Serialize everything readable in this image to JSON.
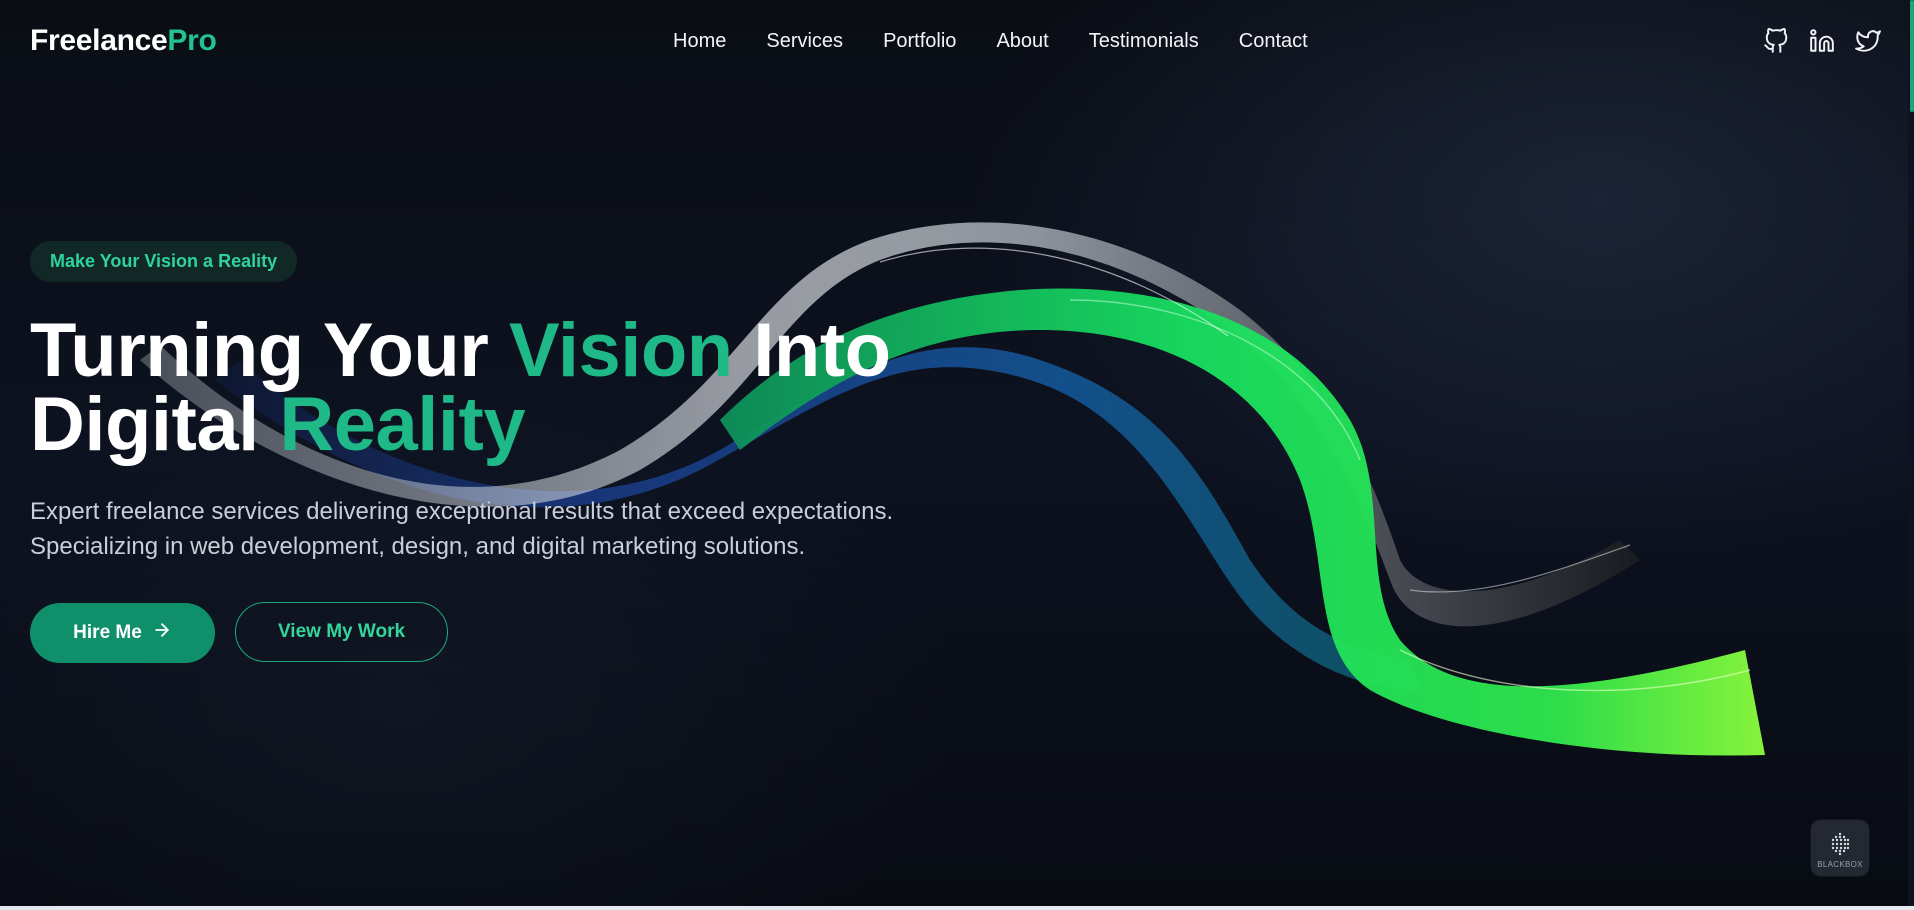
{
  "header": {
    "logo_main": "Freelance",
    "logo_accent": "Pro",
    "nav": [
      "Home",
      "Services",
      "Portfolio",
      "About",
      "Testimonials",
      "Contact"
    ],
    "socials": [
      "github-icon",
      "linkedin-icon",
      "twitter-icon"
    ]
  },
  "hero": {
    "badge": "Make Your Vision a Reality",
    "headline": {
      "part1": "Turning Your ",
      "highlight1": "Vision",
      "part2": " Into",
      "part3": "Digital ",
      "highlight2": "Reality"
    },
    "subtext_line1": "Expert freelance services delivering exceptional results that exceed expectations.",
    "subtext_line2": "Specializing in web development, design, and digital marketing solutions.",
    "primary_button": "Hire Me",
    "secondary_button": "View My Work"
  },
  "widget": {
    "label": "BLACKBOX"
  },
  "colors": {
    "accent": "#1fb887",
    "button_primary": "#10906a",
    "background": "#0b0f17"
  }
}
